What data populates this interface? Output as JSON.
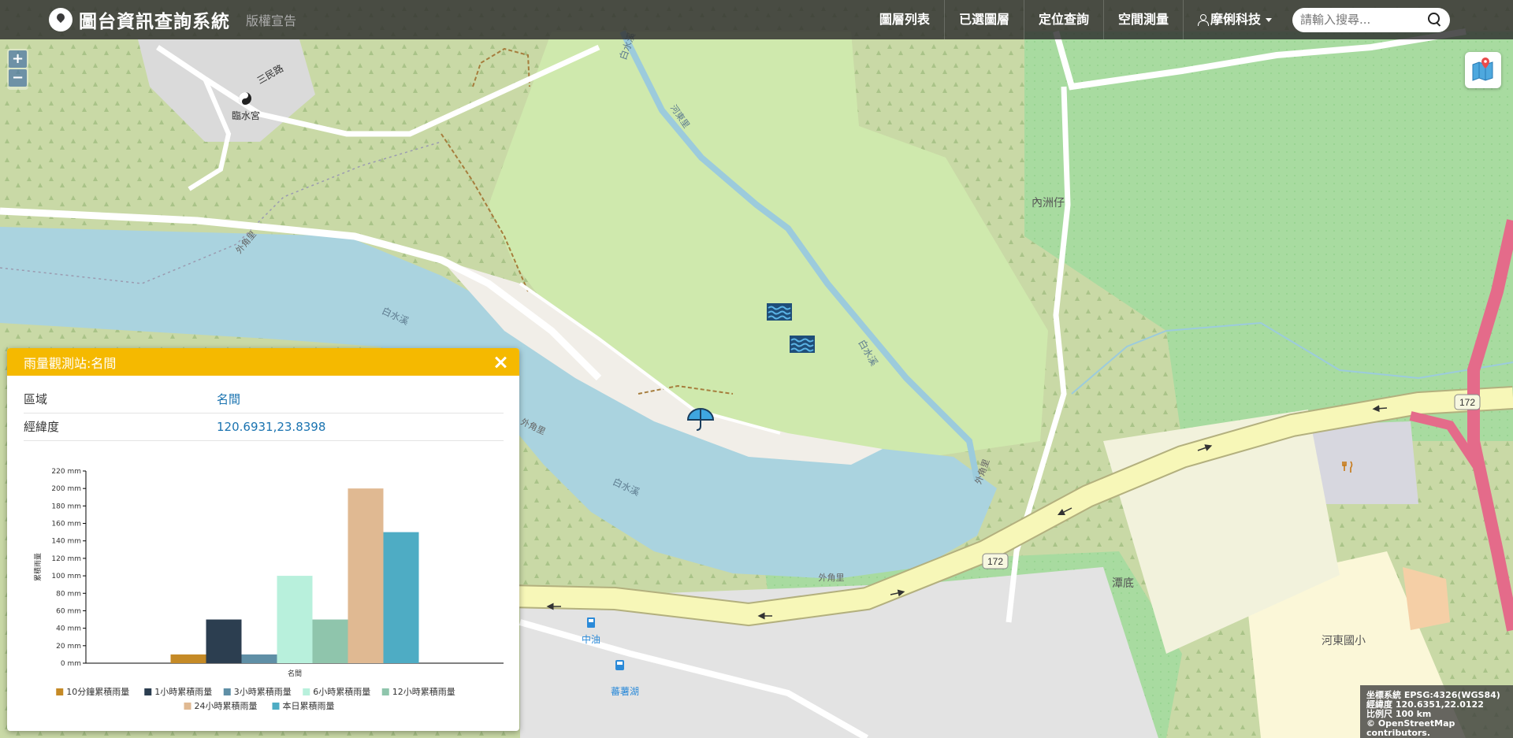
{
  "navbar": {
    "title": "圖台資訊查詢系統",
    "copyright_link": "版權宣告",
    "menu": [
      "圖層列表",
      "已選圖層",
      "定位查詢",
      "空間測量"
    ],
    "user": "摩俐科技",
    "search_placeholder": "請輸入搜尋..."
  },
  "zoom": {
    "in": "+",
    "out": "−"
  },
  "map_labels": {
    "temple": "臨水宮",
    "road_sanmin": "三民路",
    "neizhouzai": "內洲仔",
    "river_1": "白水溪",
    "river_2": "白水溪",
    "river_3": "白水溪",
    "river_4": "白水溪",
    "hedong_canal": "河東里",
    "waijiao_1": "外角里",
    "waijiao_2": "外角里",
    "waijiao_3": "外角里",
    "waijiao_4": "外角里",
    "tandi": "潭底",
    "road_172_a": "172",
    "road_172_b": "172",
    "gas_station": "中油",
    "bus_stop": "蕃薯湖",
    "school": "河東國小"
  },
  "popup": {
    "title": "雨量觀測站:名間",
    "rows": [
      {
        "label": "區域",
        "value": "名間"
      },
      {
        "label": "經緯度",
        "value": "120.6931,23.8398"
      }
    ]
  },
  "chart_data": {
    "type": "bar",
    "xlabel": "名間",
    "ylabel": "累積雨量",
    "ylim": [
      0,
      220
    ],
    "yticks": [
      "0 mm",
      "20 mm",
      "40 mm",
      "60 mm",
      "80 mm",
      "100 mm",
      "120 mm",
      "140 mm",
      "160 mm",
      "180 mm",
      "200 mm",
      "220 mm"
    ],
    "legend_position": "bottom",
    "series": [
      {
        "name": "10分鐘累積雨量",
        "value": 10,
        "color": "#c58a26"
      },
      {
        "name": "1小時累積雨量",
        "value": 50,
        "color": "#2c3e50"
      },
      {
        "name": "3小時累積雨量",
        "value": 10,
        "color": "#5f8fa6"
      },
      {
        "name": "6小時累積雨量",
        "value": 100,
        "color": "#b8f0dc"
      },
      {
        "name": "12小時累積雨量",
        "value": 50,
        "color": "#8fc5ac"
      },
      {
        "name": "24小時累積雨量",
        "value": 200,
        "color": "#e0b992"
      },
      {
        "name": "本日累積雨量",
        "value": 150,
        "color": "#4eacc4"
      }
    ]
  },
  "coord_box": {
    "line1": "坐標系統  EPSG:4326(WGS84)",
    "line2": "經緯度  120.6351,22.0122",
    "line3": "比例尺  100 km",
    "line4": "© OpenStreetMap contributors."
  }
}
